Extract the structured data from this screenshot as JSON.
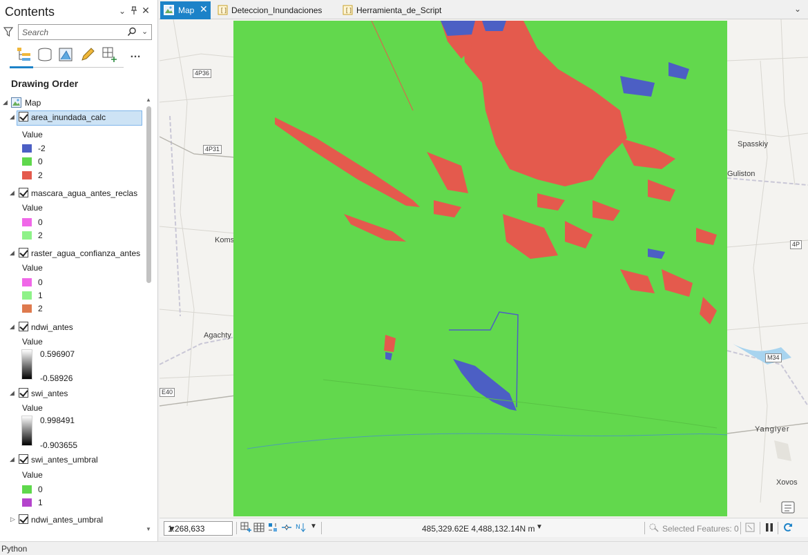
{
  "contents": {
    "title": "Contents",
    "search_placeholder": "Search",
    "drawing_order": "Drawing Order",
    "map_node": "Map",
    "layers": [
      {
        "name": "area_inundada_calc",
        "value_label": "Value",
        "legend": [
          {
            "label": "-2",
            "color": "#4c5fc4"
          },
          {
            "label": "0",
            "color": "#5fd84c"
          },
          {
            "label": "2",
            "color": "#e45a4d"
          }
        ]
      },
      {
        "name": "mascara_agua_antes_reclas",
        "value_label": "Value",
        "legend": [
          {
            "label": "0",
            "color": "#f068e8"
          },
          {
            "label": "2",
            "color": "#8ef288"
          }
        ]
      },
      {
        "name": "raster_agua_confianza_antes",
        "value_label": "Value",
        "legend": [
          {
            "label": "0",
            "color": "#f068e8"
          },
          {
            "label": "1",
            "color": "#8ef288"
          },
          {
            "label": "2",
            "color": "#de7a4e"
          }
        ]
      },
      {
        "name": "ndwi_antes",
        "value_label": "Value",
        "high": "0.596907",
        "low": "-0.58926"
      },
      {
        "name": "swi_antes",
        "value_label": "Value",
        "high": "0.998491",
        "low": "-0.903655"
      },
      {
        "name": "swi_antes_umbral",
        "value_label": "Value",
        "legend": [
          {
            "label": "0",
            "color": "#5fd84c"
          },
          {
            "label": "1",
            "color": "#b444cc"
          }
        ]
      },
      {
        "name": "ndwi_antes_umbral"
      }
    ]
  },
  "tabs": [
    {
      "label": "Map",
      "icon": "map-icon",
      "active": true
    },
    {
      "label": "Deteccion_Inundaciones",
      "icon": "notebook-icon",
      "active": false
    },
    {
      "label": "Herramienta_de_Script",
      "icon": "notebook-icon",
      "active": false
    }
  ],
  "map": {
    "place_labels": [
      "Spasskiy",
      "Guliston",
      "Komsomol",
      "Agachty",
      "Yangiyer",
      "Xovos"
    ],
    "road_shields": [
      "4P36",
      "4P31",
      "4P",
      "M34",
      "E40"
    ],
    "colors": {
      "green": "#62d84d",
      "red": "#e45a4d",
      "blue": "#4c5fc4",
      "accent": "#1c82c8"
    }
  },
  "mapbar": {
    "scale": "1:268,633",
    "coordinates": "485,329.62E 4,488,132.14N m",
    "selected_features": "Selected Features: 0"
  },
  "status": {
    "text": "Python"
  }
}
